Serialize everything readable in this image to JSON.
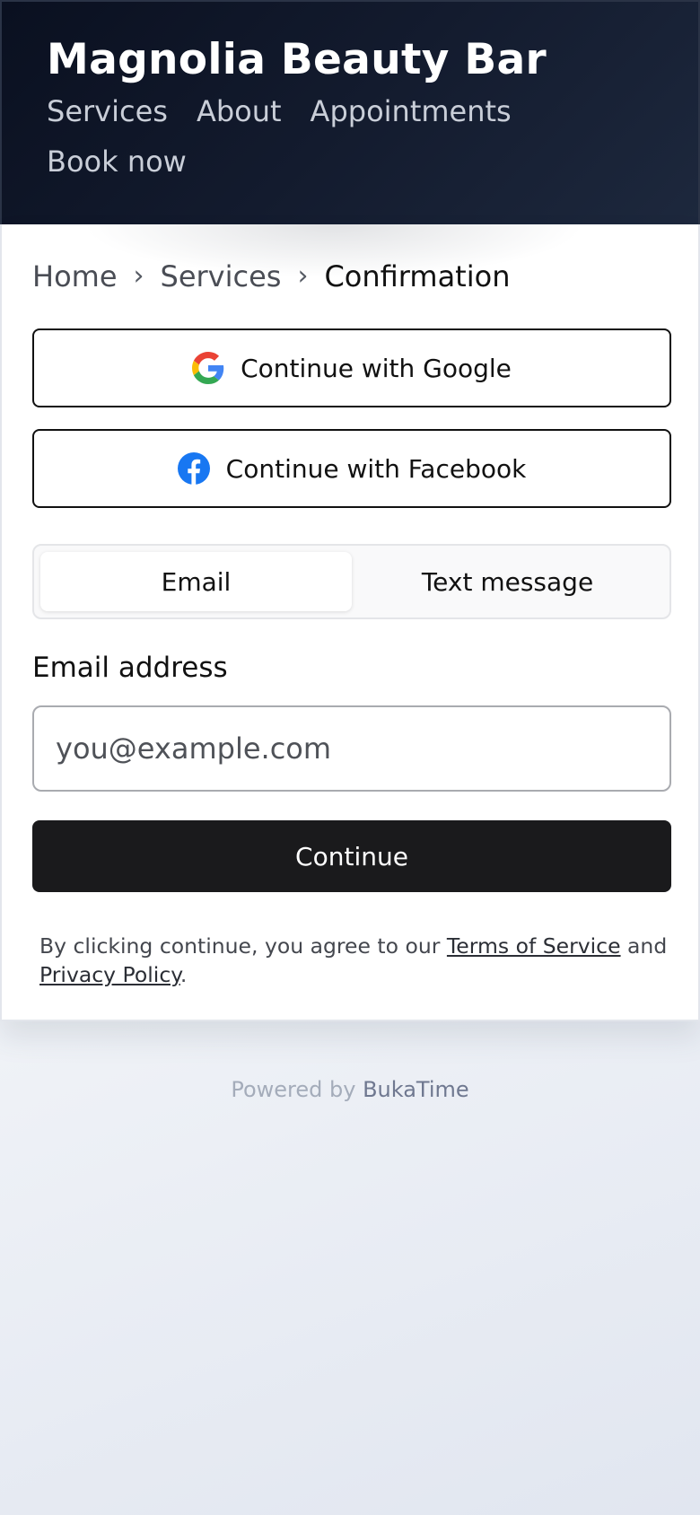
{
  "header": {
    "title": "Magnolia Beauty Bar",
    "nav": [
      "Services",
      "About",
      "Appointments",
      "Book now"
    ]
  },
  "breadcrumb": {
    "items": [
      "Home",
      "Services",
      "Confirmation"
    ],
    "separator": "›"
  },
  "auth": {
    "google_label": "Continue with Google",
    "facebook_label": "Continue with Facebook",
    "icons": {
      "google": "google-icon",
      "facebook": "facebook-icon"
    }
  },
  "tabs": {
    "items": [
      "Email",
      "Text message"
    ],
    "active": "Email"
  },
  "form": {
    "email_label": "Email address",
    "email_placeholder": "you@example.com",
    "email_value": "",
    "continue_label": "Continue"
  },
  "legal": {
    "prefix": "By clicking continue, you agree to our ",
    "terms_label": "Terms of Service",
    "and": " and ",
    "privacy_label": "Privacy Policy",
    "suffix": "."
  },
  "footer": {
    "powered_prefix": "Powered by ",
    "powered_brand": "BukaTime"
  },
  "colors": {
    "header_bg": "#131b2e",
    "primary_button": "#1a1a1c",
    "facebook_blue": "#1877F2",
    "google_blue": "#4285F4",
    "google_red": "#EA4335",
    "google_yellow": "#FBBC05",
    "google_green": "#34A853"
  }
}
